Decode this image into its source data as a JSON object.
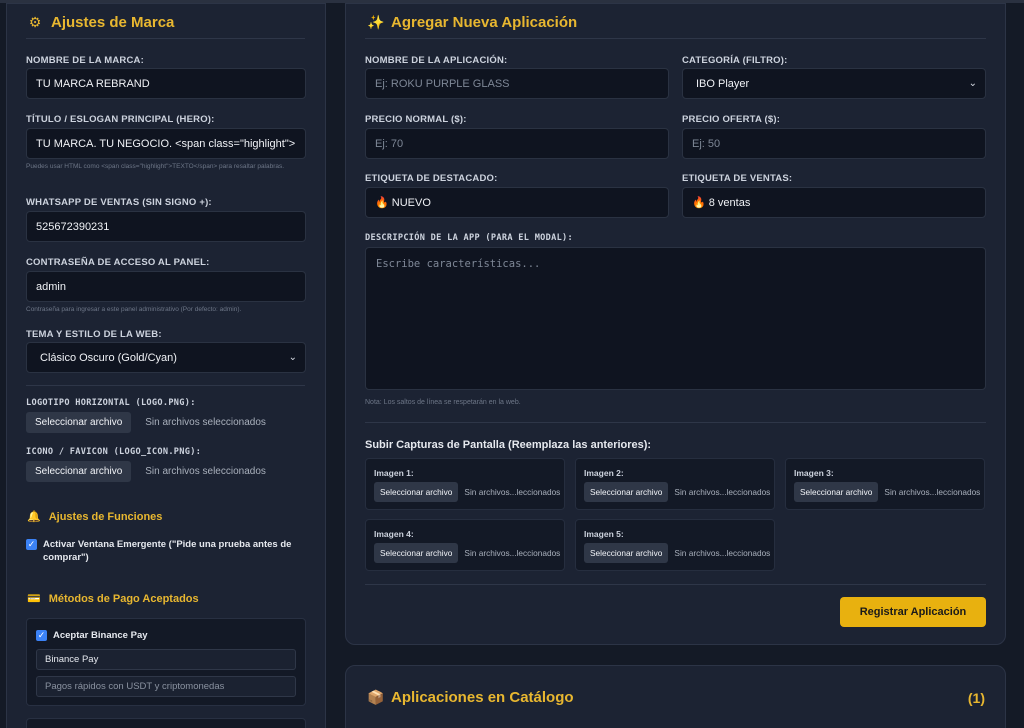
{
  "brand": {
    "title": "Ajustes de Marca",
    "icon": "gear-icon",
    "name_label": "NOMBRE DE LA MARCA:",
    "name_value": "TU MARCA REBRAND",
    "hero_label": "TÍTULO / ESLOGAN PRINCIPAL (HERO):",
    "hero_value": "TU MARCA. TU NEGOCIO. <span class=\"highlight\">",
    "hero_hint": "Puedes usar HTML como <span class=\"highlight\">TEXTO</span> para resaltar palabras.",
    "whatsapp_label": "WHATSAPP DE VENTAS (SIN SIGNO +):",
    "whatsapp_value": "525672390231",
    "password_label": "CONTRASEÑA DE ACCESO AL PANEL:",
    "password_value": "admin",
    "password_hint": "Contraseña para ingresar a este panel administrativo (Por defecto: admin).",
    "theme_label": "TEMA Y ESTILO DE LA WEB:",
    "theme_value": "Clásico Oscuro (Gold/Cyan)",
    "logo_label": "LOGOTIPO HORIZONTAL (LOGO.PNG):",
    "favicon_label": "ICONO / FAVICON (LOGO_ICON.PNG):",
    "file_button": "Seleccionar archivo",
    "file_none": "Sin archivos seleccionados"
  },
  "features": {
    "title": "Ajustes de Funciones",
    "icon": "bell-icon",
    "popup_label": "Activar Ventana Emergente (\"Pide una prueba antes de comprar\")",
    "popup_checked": true
  },
  "payments": {
    "title": "Métodos de Pago Aceptados",
    "icon": "credit-card-icon",
    "binance_label": "Aceptar Binance Pay",
    "binance_checked": true,
    "binance_name": "Binance Pay",
    "binance_desc": "Pagos rápidos con USDT y criptomonedas"
  },
  "new_app": {
    "title": "Agregar Nueva Aplicación",
    "icon": "sparkles-icon",
    "name_label": "NOMBRE DE LA APLICACIÓN:",
    "name_placeholder": "Ej: ROKU PURPLE GLASS",
    "category_label": "CATEGORÍA (FILTRO):",
    "category_value": "IBO Player",
    "price_label": "PRECIO NORMAL ($):",
    "price_placeholder": "Ej: 70",
    "offer_label": "PRECIO OFERTA ($):",
    "offer_placeholder": "Ej: 50",
    "badge_label": "ETIQUETA DE DESTACADO:",
    "badge_value": "🔥 NUEVO",
    "sales_label": "ETIQUETA DE VENTAS:",
    "sales_value": "🔥 8 ventas",
    "desc_label": "DESCRIPCIÓN DE LA APP (PARA EL MODAL):",
    "desc_placeholder": "Escribe características...",
    "desc_hint": "Nota: Los saltos de línea se respetarán en la web.",
    "screens_title": "Subir Capturas de Pantalla (Reemplaza las anteriores):",
    "screens": [
      {
        "label": "Imagen 1:"
      },
      {
        "label": "Imagen 2:"
      },
      {
        "label": "Imagen 3:"
      },
      {
        "label": "Imagen 4:"
      },
      {
        "label": "Imagen 5:"
      }
    ],
    "file_button": "Seleccionar archivo",
    "file_none_short": "Sin archivos...leccionados",
    "submit_label": "Registrar Aplicación"
  },
  "catalog": {
    "title": "Aplicaciones en Catálogo",
    "icon": "package-icon",
    "count": "(1)"
  }
}
